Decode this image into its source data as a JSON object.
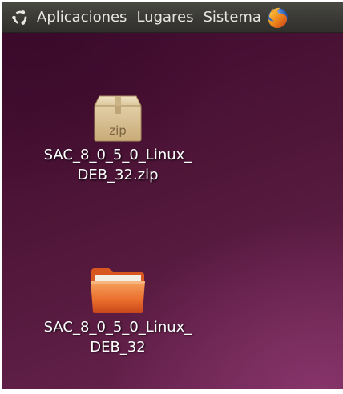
{
  "top_panel": {
    "menus": {
      "applications": "Aplicaciones",
      "places": "Lugares",
      "system": "Sistema"
    },
    "colors": {
      "panel": "#3b3a36",
      "text": "#e8e6e1"
    }
  },
  "desktop": {
    "background_color": "#501639",
    "icons": [
      {
        "type": "zip-archive",
        "label_line1": "SAC_8_0_5_0_Linux_",
        "label_line2": "DEB_32.zip",
        "badge": "zip"
      },
      {
        "type": "folder",
        "label_line1": "SAC_8_0_5_0_Linux_",
        "label_line2": "DEB_32"
      }
    ]
  }
}
